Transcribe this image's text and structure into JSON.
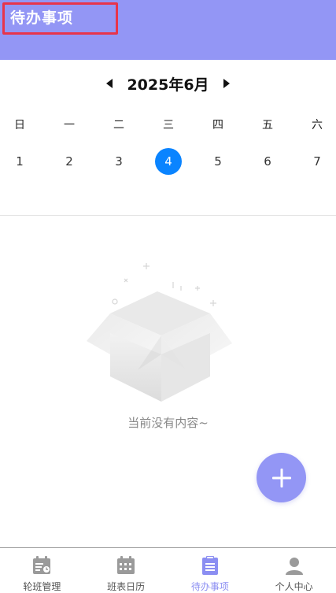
{
  "header": {
    "title": "待办事项"
  },
  "calendar": {
    "month_label": "2025年6月",
    "weekdays": [
      "日",
      "一",
      "二",
      "三",
      "四",
      "五",
      "六"
    ],
    "dates": [
      "1",
      "2",
      "3",
      "4",
      "5",
      "6",
      "7"
    ],
    "selected_date": "4",
    "selected_color": "#0a84ff"
  },
  "empty_state": {
    "text": "当前没有内容~",
    "icon": "empty-box-icon"
  },
  "fab": {
    "icon": "plus-icon"
  },
  "tabs": [
    {
      "label": "轮班管理",
      "icon": "schedule-icon",
      "active": false
    },
    {
      "label": "班表日历",
      "icon": "calendar-icon",
      "active": false
    },
    {
      "label": "待办事项",
      "icon": "clipboard-icon",
      "active": true
    },
    {
      "label": "个人中心",
      "icon": "user-icon",
      "active": false
    }
  ],
  "colors": {
    "brand": "#9396f5",
    "highlight_border": "#e8344b",
    "tab_active": "#8b8ef2"
  }
}
